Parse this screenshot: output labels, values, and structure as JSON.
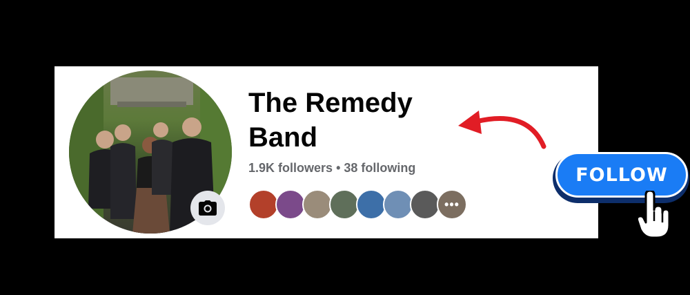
{
  "profile": {
    "name": "The Remedy Band",
    "followers": "1.9K followers",
    "separator": "•",
    "following": "38 following",
    "avatar_icon": "band-photo",
    "camera_icon": "camera-icon"
  },
  "friends": {
    "more_label": "•••",
    "colors": [
      "#b3402a",
      "#7b4a8a",
      "#9a8c7a",
      "#5f6f5a",
      "#3d6fa8",
      "#6f8fb5",
      "#5a5a5a",
      "#7c6e60"
    ]
  },
  "cta": {
    "follow_label": "FOLLOW",
    "accent": "#1a7cf5",
    "arrow_color": "#e11d25"
  }
}
